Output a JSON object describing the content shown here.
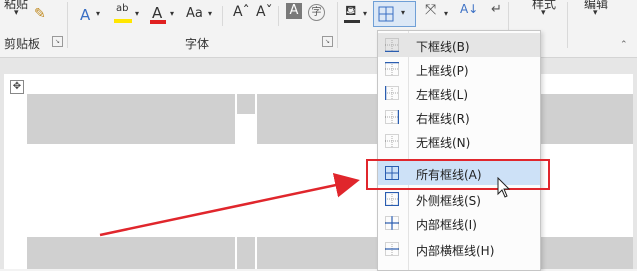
{
  "ribbon": {
    "clipboard_top_label": "粘贴",
    "clipboard_label": "剪贴板",
    "font_group_label": "字体",
    "style_label": "样式",
    "edit_label": "编辑",
    "font_size_label": "Aa"
  },
  "border_menu": {
    "items": [
      {
        "label": "下框线(B)",
        "icon": "border-bottom-icon"
      },
      {
        "label": "上框线(P)",
        "icon": "border-top-icon"
      },
      {
        "label": "左框线(L)",
        "icon": "border-left-icon"
      },
      {
        "label": "右框线(R)",
        "icon": "border-right-icon"
      },
      {
        "label": "无框线(N)",
        "icon": "border-none-icon"
      },
      {
        "label": "所有框线(A)",
        "icon": "border-all-icon"
      },
      {
        "label": "外侧框线(S)",
        "icon": "border-outside-icon"
      },
      {
        "label": "内部框线(I)",
        "icon": "border-inside-icon"
      },
      {
        "label": "内部横框线(H)",
        "icon": "border-inside-horizontal-icon"
      }
    ],
    "selected_index": 5
  },
  "colors": {
    "highlight": "#e0262c",
    "menu_selected": "#cde1f7"
  }
}
